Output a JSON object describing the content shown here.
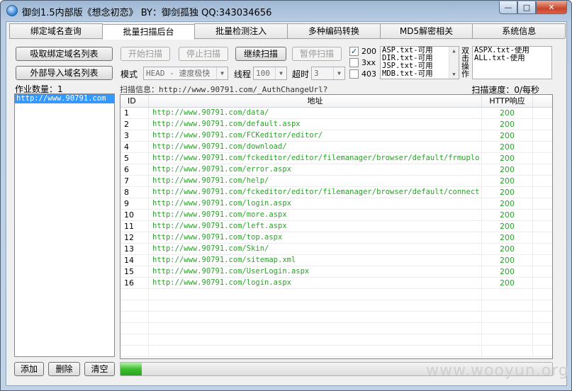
{
  "window": {
    "title": "御剑1.5内部版《想念初恋》 BY：御剑孤独 QQ:343034656",
    "min_glyph": "—",
    "max_glyph": "□",
    "close_glyph": "✕"
  },
  "tabs": [
    "绑定域名查询",
    "批量扫描后台",
    "批量检测注入",
    "多种编码转换",
    "MD5解密相关",
    "系统信息"
  ],
  "active_tab": 1,
  "left": {
    "import_bound_label": "吸取绑定域名列表",
    "import_external_label": "外部导入域名列表",
    "job_count_label": "作业数量：1",
    "domains": [
      "http://www.90791.com"
    ],
    "add_label": "添加",
    "delete_label": "删除",
    "clear_label": "清空"
  },
  "controls": {
    "start_label": "开始扫描",
    "stop_label": "停止扫描",
    "continue_label": "继续扫描",
    "pause_label": "暂停扫描",
    "mode_label": "模式",
    "mode_value": "HEAD - 速度极快",
    "threads_label": "线程",
    "threads_value": "100",
    "timeout_label": "超时",
    "timeout_value": "3",
    "status_200": "200",
    "status_3xx": "3xx",
    "status_403": "403",
    "dicts": [
      "ASP.txt-可用",
      "DIR.txt-可用",
      "JSP.txt-可用",
      "MDB.txt-可用"
    ],
    "dblclick_hint": "双击操作",
    "dicts2": [
      "ASPX.txt-使用",
      "ALL.txt-使用"
    ]
  },
  "scan": {
    "info_label": "扫描信息：",
    "info_value": "http://www.90791.com/_AuthChangeUrl?",
    "speed": "扫描速度：0/每秒",
    "progress": 0.05
  },
  "table": {
    "headers": {
      "id": "ID",
      "url": "地址",
      "code": "HTTP响应"
    },
    "rows": [
      {
        "id": "1",
        "url": "http://www.90791.com/data/",
        "code": "200"
      },
      {
        "id": "2",
        "url": "http://www.90791.com/default.aspx",
        "code": "200"
      },
      {
        "id": "3",
        "url": "http://www.90791.com/FCKeditor/editor/",
        "code": "200"
      },
      {
        "id": "4",
        "url": "http://www.90791.com/download/",
        "code": "200"
      },
      {
        "id": "5",
        "url": "http://www.90791.com/fckeditor/editor/filemanager/browser/default/frmuplo...",
        "code": "200"
      },
      {
        "id": "6",
        "url": "http://www.90791.com/error.aspx",
        "code": "200"
      },
      {
        "id": "7",
        "url": "http://www.90791.com/help/",
        "code": "200"
      },
      {
        "id": "8",
        "url": "http://www.90791.com/fckeditor/editor/filemanager/browser/default/connect...",
        "code": "200"
      },
      {
        "id": "9",
        "url": "http://www.90791.com/login.aspx",
        "code": "200"
      },
      {
        "id": "10",
        "url": "http://www.90791.com/more.aspx",
        "code": "200"
      },
      {
        "id": "11",
        "url": "http://www.90791.com/left.aspx",
        "code": "200"
      },
      {
        "id": "12",
        "url": "http://www.90791.com/top.aspx",
        "code": "200"
      },
      {
        "id": "13",
        "url": "http://www.90791.com/Skin/",
        "code": "200"
      },
      {
        "id": "14",
        "url": "http://www.90791.com/sitemap.xml",
        "code": "200"
      },
      {
        "id": "15",
        "url": "http://www.90791.com/UserLogin.aspx",
        "code": "200"
      },
      {
        "id": "16",
        "url": "http://www.90791.com/login.aspx",
        "code": "200"
      }
    ]
  },
  "watermark": "www.wooyun.org"
}
